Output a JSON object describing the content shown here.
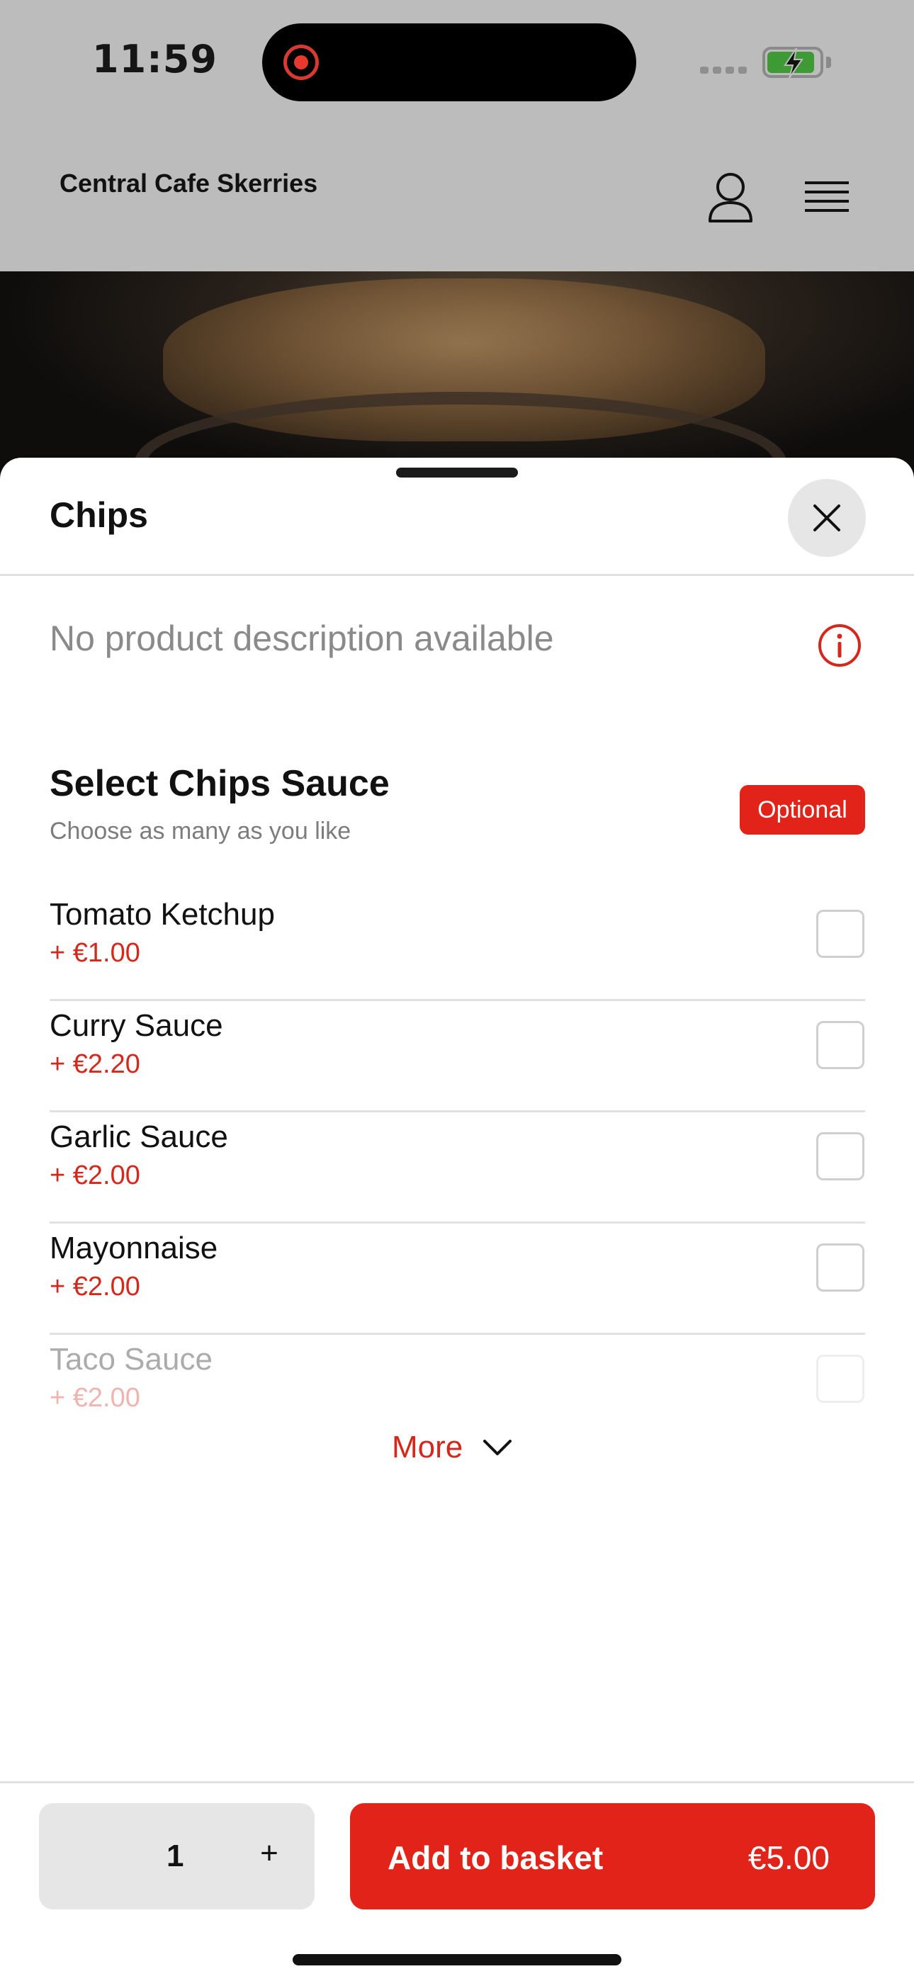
{
  "status_bar": {
    "time": "11:59"
  },
  "header": {
    "restaurant_name": "Central Cafe Skerries",
    "account_icon": "user-icon",
    "menu_icon": "hamburger-menu-icon"
  },
  "product": {
    "title": "Chips",
    "description": "No product description available"
  },
  "options_group": {
    "title": "Select Chips Sauce",
    "subtitle": "Choose as many as you like",
    "badge": "Optional",
    "items": [
      {
        "name": "Tomato Ketchup",
        "price": "+ €1.00",
        "checked": false
      },
      {
        "name": "Curry Sauce",
        "price": "+ €2.20",
        "checked": false
      },
      {
        "name": "Garlic Sauce",
        "price": "+ €2.00",
        "checked": false
      },
      {
        "name": "Mayonnaise",
        "price": "+ €2.00",
        "checked": false
      },
      {
        "name": "Taco Sauce",
        "price": "+ €2.00",
        "checked": false
      }
    ],
    "more_label": "More"
  },
  "footer": {
    "quantity": "1",
    "plus_label": "+",
    "add_label": "Add to basket",
    "total": "€5.00"
  },
  "colors": {
    "accent": "#e2231a",
    "price": "#d5281d",
    "overlay": "#bcbcbc"
  }
}
